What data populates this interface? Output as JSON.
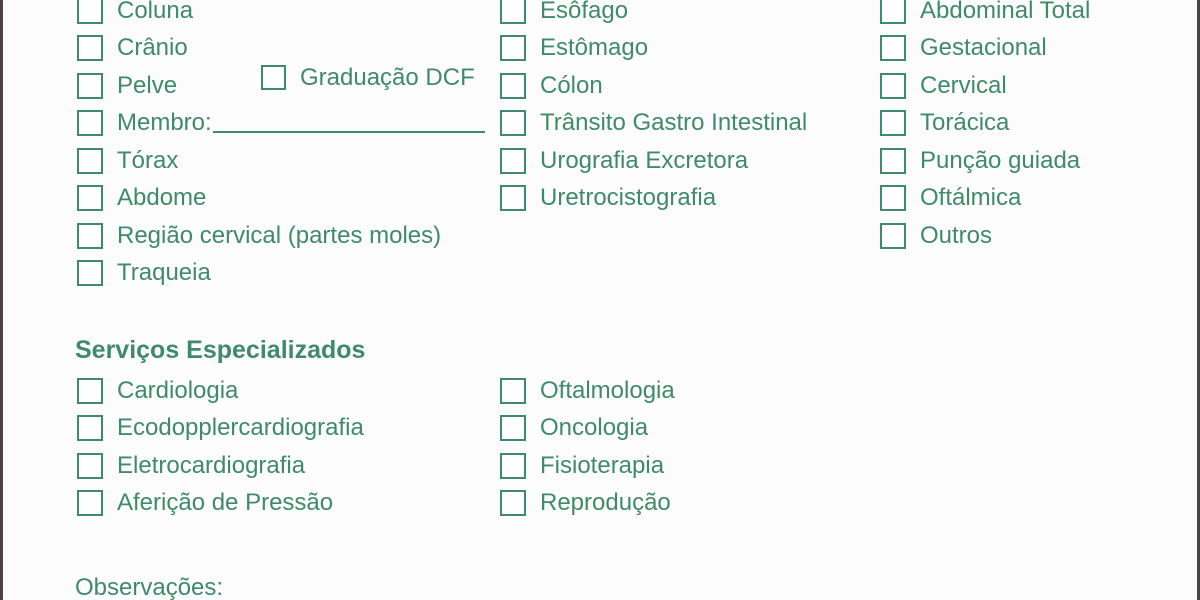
{
  "colors": {
    "accent_green": "#3f8a6d",
    "page_background": "#fcfcfc",
    "page_border": "#4a4246"
  },
  "exames": {
    "column_1": [
      {
        "label": "Coluna",
        "type": "checkbox"
      },
      {
        "label": "Crânio",
        "type": "checkbox"
      },
      {
        "label": "Pelve",
        "type": "checkbox"
      },
      {
        "label": "Membro:",
        "type": "checkbox-with-write-in",
        "write_in_value": ""
      },
      {
        "label": "Tórax",
        "type": "checkbox"
      },
      {
        "label": "Abdome",
        "type": "checkbox"
      },
      {
        "label": "Região cervical (partes moles)",
        "type": "checkbox"
      },
      {
        "label": "Traqueia",
        "type": "checkbox"
      }
    ],
    "column_1_inline": {
      "label": "Graduação DCF",
      "type": "checkbox"
    },
    "column_2": [
      {
        "label": "Esôfago",
        "type": "checkbox"
      },
      {
        "label": "Estômago",
        "type": "checkbox"
      },
      {
        "label": "Cólon",
        "type": "checkbox"
      },
      {
        "label": "Trânsito Gastro Intestinal",
        "type": "checkbox"
      },
      {
        "label": "Urografia Excretora",
        "type": "checkbox"
      },
      {
        "label": "Uretrocistografia",
        "type": "checkbox"
      }
    ],
    "column_3": [
      {
        "label": "Abdominal Total",
        "type": "checkbox"
      },
      {
        "label": "Gestacional",
        "type": "checkbox"
      },
      {
        "label": "Cervical",
        "type": "checkbox"
      },
      {
        "label": "Torácica",
        "type": "checkbox"
      },
      {
        "label": "Punção guiada",
        "type": "checkbox"
      },
      {
        "label": "Oftálmica",
        "type": "checkbox"
      },
      {
        "label": "Outros",
        "type": "checkbox"
      }
    ]
  },
  "servicos_especializados": {
    "heading": "Serviços Especializados",
    "column_1": [
      {
        "label": "Cardiologia",
        "type": "checkbox"
      },
      {
        "label": "Ecodopplercardiografia",
        "type": "checkbox"
      },
      {
        "label": "Eletrocardiografia",
        "type": "checkbox"
      },
      {
        "label": "Aferição de Pressão",
        "type": "checkbox"
      }
    ],
    "column_2": [
      {
        "label": "Oftalmologia",
        "type": "checkbox"
      },
      {
        "label": "Oncologia",
        "type": "checkbox"
      },
      {
        "label": "Fisioterapia",
        "type": "checkbox"
      },
      {
        "label": "Reprodução",
        "type": "checkbox"
      }
    ]
  },
  "observacoes": {
    "label": "Observações:"
  }
}
